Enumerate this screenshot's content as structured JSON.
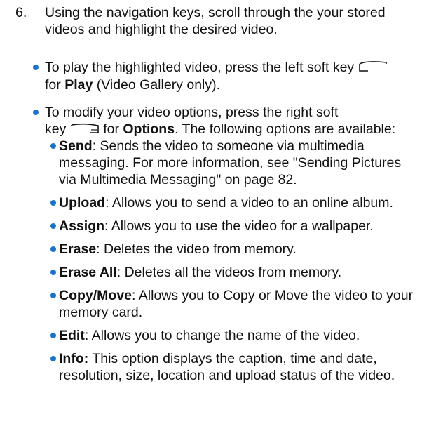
{
  "step": {
    "number": "6.",
    "text": "Using the navigation keys, scroll through the your stored videos and highlight the desired video."
  },
  "play": {
    "before": "To play the highlighted video, press the left soft key",
    "mid": "for",
    "bold": "Play",
    "after": "(Video Gallery only)."
  },
  "options": {
    "line1": "To modify your video options, press the right soft",
    "before_key": "key",
    "mid": "for",
    "bold": "Options",
    "after": ". The following options are available:"
  },
  "items": [
    {
      "term": "Send",
      "colon": ":",
      "desc": "Sends the video to someone via multimedia messaging. For more information, see \"Sending Pictures via Multimedia Messaging\" on page 82."
    },
    {
      "term": "Upload",
      "colon": ":",
      "desc": "Allows you to send a video to an online album."
    },
    {
      "term": "Assign",
      "colon": ":",
      "desc": "Allows you to use the video for a wallpaper."
    },
    {
      "term": "Erase",
      "colon": ":",
      "desc": "Deletes the video from memory."
    },
    {
      "term": "Erase All",
      "colon": ":",
      "desc": "Deletes all the videos from memory."
    },
    {
      "term": "Copy/Move",
      "colon": ":",
      "desc": "Allows you to Copy or Move the video to your memory card."
    },
    {
      "term": "Edit",
      "colon": ":",
      "desc": "Allows you to change the name of the video."
    },
    {
      "term": "Info:",
      "colon": "",
      "desc": "This option displays the caption, time and date, resolution, size, location and upload status of the video."
    }
  ],
  "colors": {
    "bullet": "#1a73c9",
    "text": "#111111"
  },
  "icons": {
    "left_soft_key": "left-soft-key-icon",
    "right_soft_key": "right-soft-key-icon"
  }
}
